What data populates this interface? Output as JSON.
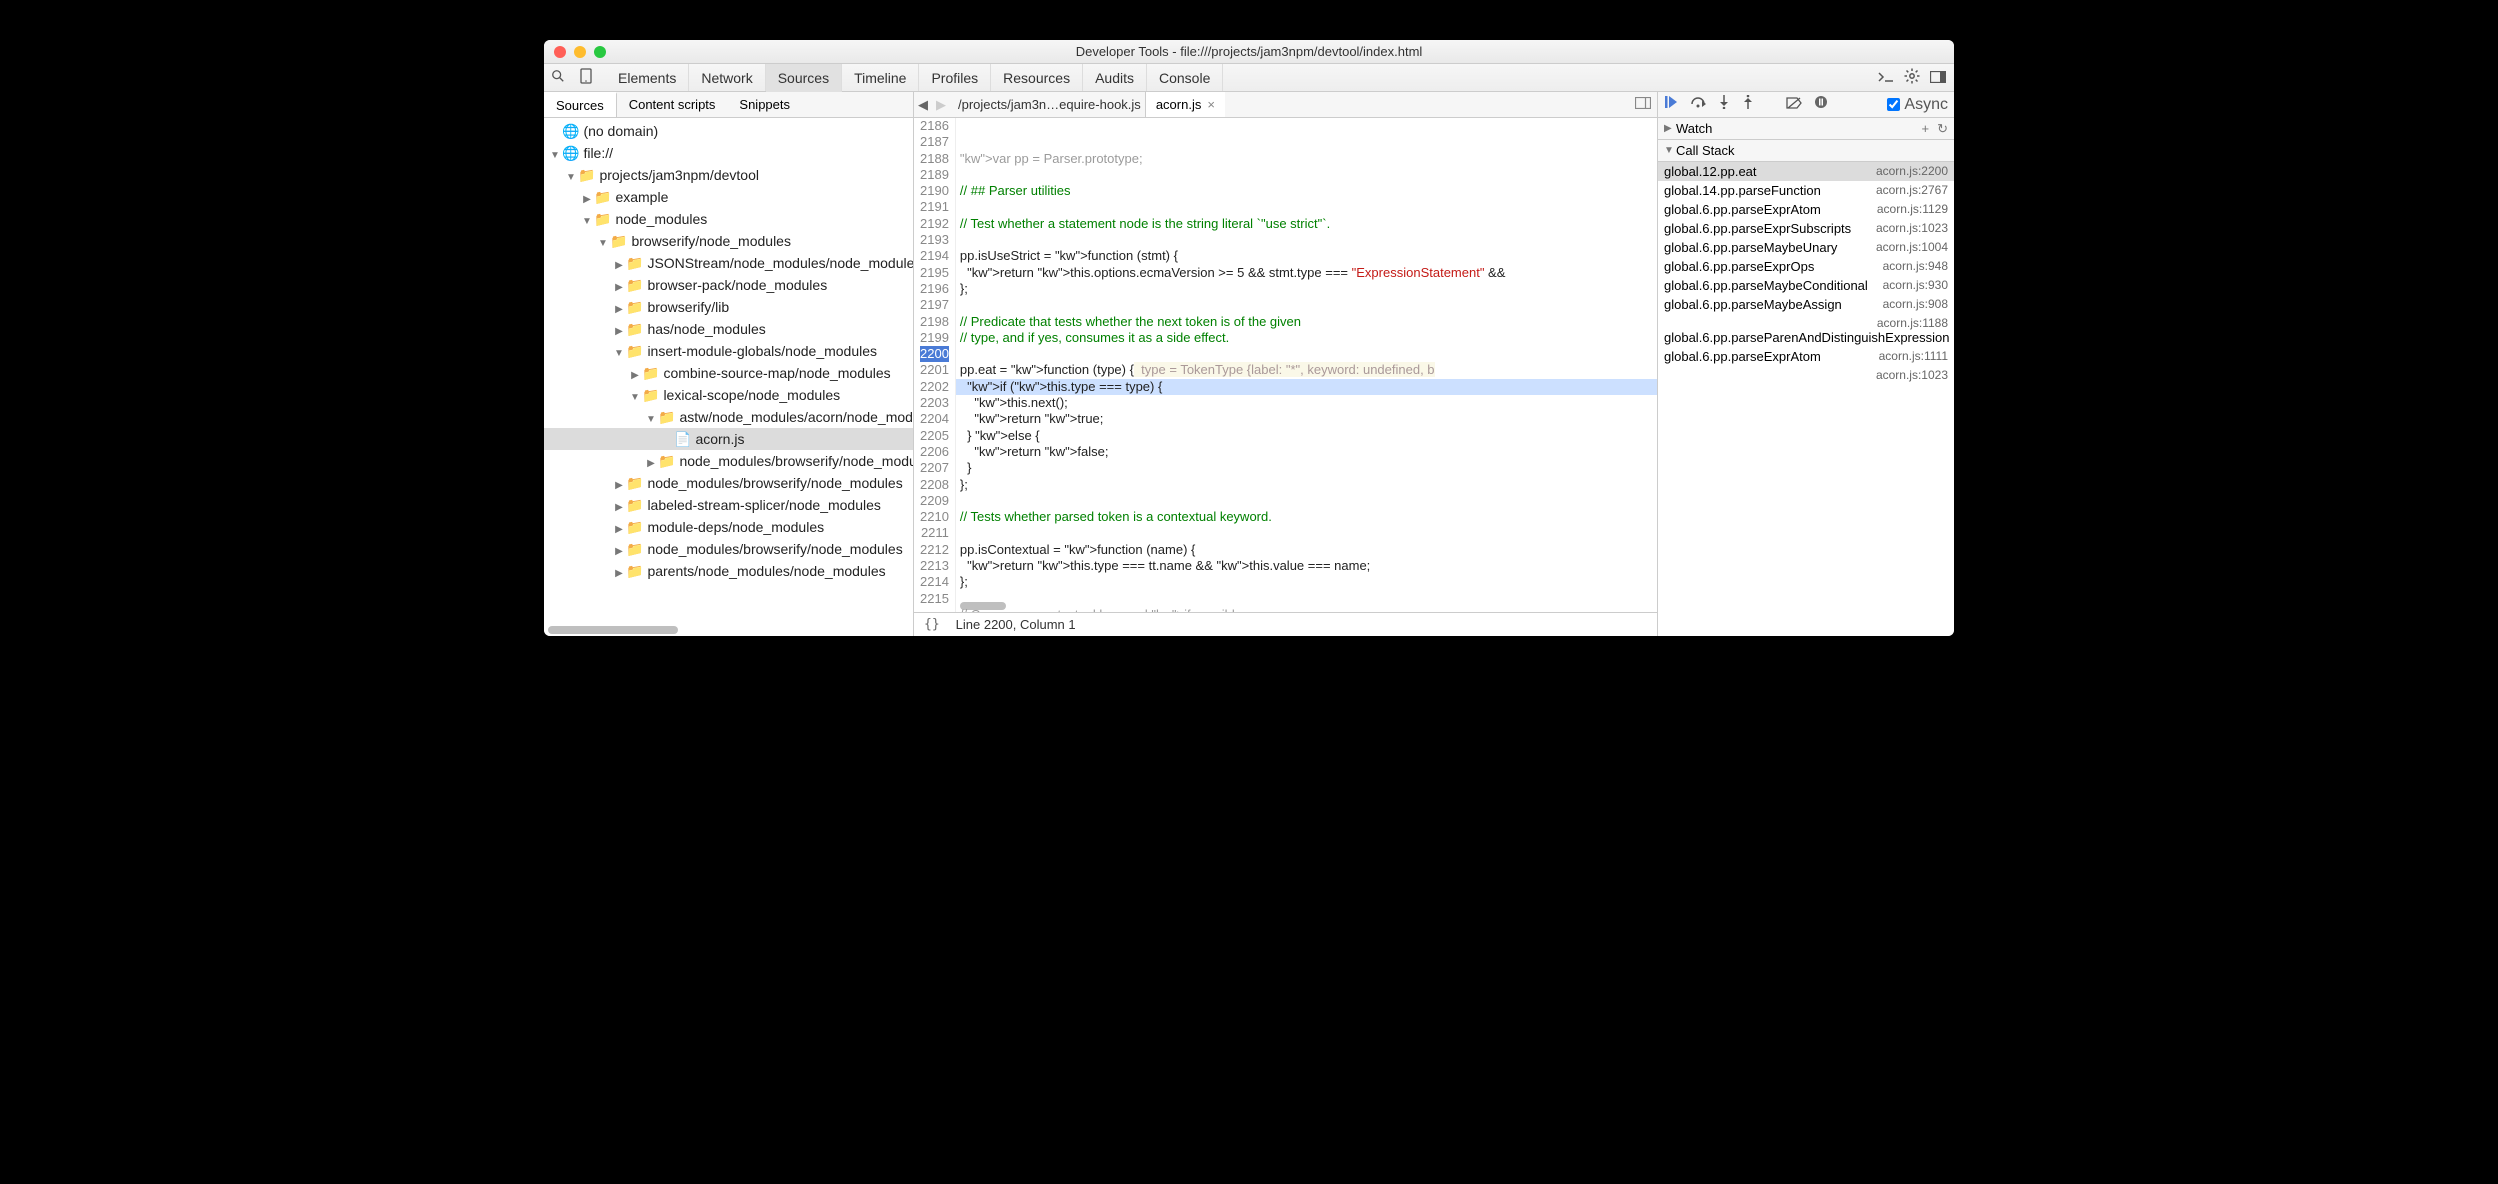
{
  "window": {
    "title": "Developer Tools - file:///projects/jam3npm/devtool/index.html"
  },
  "main_tabs": [
    "Elements",
    "Network",
    "Sources",
    "Timeline",
    "Profiles",
    "Resources",
    "Audits",
    "Console"
  ],
  "main_tab_active": "Sources",
  "panel_tabs": [
    "Sources",
    "Content scripts",
    "Snippets"
  ],
  "panel_tab_active": "Sources",
  "tree": [
    {
      "depth": 0,
      "open": true,
      "icon": "globe",
      "label": "(no domain)",
      "nochild": true
    },
    {
      "depth": 0,
      "open": true,
      "icon": "globe",
      "label": "file://"
    },
    {
      "depth": 1,
      "open": true,
      "icon": "folder",
      "label": "projects/jam3npm/devtool"
    },
    {
      "depth": 2,
      "open": false,
      "icon": "folder",
      "label": "example"
    },
    {
      "depth": 2,
      "open": true,
      "icon": "folder",
      "label": "node_modules"
    },
    {
      "depth": 3,
      "open": true,
      "icon": "folder",
      "label": "browserify/node_modules"
    },
    {
      "depth": 4,
      "open": false,
      "icon": "folder",
      "label": "JSONStream/node_modules/node_modules"
    },
    {
      "depth": 4,
      "open": false,
      "icon": "folder",
      "label": "browser-pack/node_modules"
    },
    {
      "depth": 4,
      "open": false,
      "icon": "folder",
      "label": "browserify/lib"
    },
    {
      "depth": 4,
      "open": false,
      "icon": "folder",
      "label": "has/node_modules"
    },
    {
      "depth": 4,
      "open": true,
      "icon": "folder",
      "label": "insert-module-globals/node_modules"
    },
    {
      "depth": 5,
      "open": false,
      "icon": "folder",
      "label": "combine-source-map/node_modules"
    },
    {
      "depth": 5,
      "open": true,
      "icon": "folder",
      "label": "lexical-scope/node_modules"
    },
    {
      "depth": 6,
      "open": true,
      "icon": "folder",
      "label": "astw/node_modules/acorn/node_modules"
    },
    {
      "depth": 7,
      "open": false,
      "icon": "file",
      "label": "acorn.js",
      "sel": true,
      "leaf": true
    },
    {
      "depth": 6,
      "open": false,
      "icon": "folder",
      "label": "node_modules/browserify/node_modules"
    },
    {
      "depth": 4,
      "open": false,
      "icon": "folder",
      "label": "node_modules/browserify/node_modules"
    },
    {
      "depth": 4,
      "open": false,
      "icon": "folder",
      "label": "labeled-stream-splicer/node_modules"
    },
    {
      "depth": 4,
      "open": false,
      "icon": "folder",
      "label": "module-deps/node_modules"
    },
    {
      "depth": 4,
      "open": false,
      "icon": "folder",
      "label": "node_modules/browserify/node_modules"
    },
    {
      "depth": 4,
      "open": false,
      "icon": "folder",
      "label": "parents/node_modules/node_modules"
    }
  ],
  "editor": {
    "crumb": "/projects/jam3n…equire-hook.js",
    "active_tab": "acorn.js",
    "first_line": 2186,
    "current_line": 2200,
    "lines": [
      {
        "t": "var pp = Parser.prototype;",
        "cls": "kw faded"
      },
      {
        "t": ""
      },
      {
        "t": "// ## Parser utilities",
        "cls": "cm"
      },
      {
        "t": ""
      },
      {
        "t": "// Test whether a statement node is the string literal `\"use strict\"`.",
        "cls": "cm"
      },
      {
        "t": ""
      },
      {
        "t": "pp.isUseStrict = function (stmt) {"
      },
      {
        "t": "  return this.options.ecmaVersion >= 5 && stmt.type === \"ExpressionStatement\" &&"
      },
      {
        "t": "};"
      },
      {
        "t": ""
      },
      {
        "t": "// Predicate that tests whether the next token is of the given",
        "cls": "cm"
      },
      {
        "t": "// type, and if yes, consumes it as a side effect.",
        "cls": "cm"
      },
      {
        "t": ""
      },
      {
        "t": "pp.eat = function (type) {",
        "hint": "  type = TokenType {label: \"*\", keyword: undefined, b"
      },
      {
        "t": "  if (this.type === type) {",
        "hl": true
      },
      {
        "t": "    this.next();"
      },
      {
        "t": "    return true;"
      },
      {
        "t": "  } else {"
      },
      {
        "t": "    return false;"
      },
      {
        "t": "  }"
      },
      {
        "t": "};"
      },
      {
        "t": ""
      },
      {
        "t": "// Tests whether parsed token is a contextual keyword.",
        "cls": "cm"
      },
      {
        "t": ""
      },
      {
        "t": "pp.isContextual = function (name) {"
      },
      {
        "t": "  return this.type === tt.name && this.value === name;"
      },
      {
        "t": "};"
      },
      {
        "t": ""
      },
      {
        "t": "// Consumes contextual keyword if possible",
        "cls": "cm faded"
      },
      {
        "t": ""
      }
    ]
  },
  "status": {
    "braces": "{}",
    "cursor": "Line 2200, Column 1"
  },
  "watch": {
    "label": "Watch"
  },
  "callstack": {
    "label": "Call Stack",
    "frames": [
      {
        "fn": "global.12.pp.eat",
        "loc": "acorn.js:2200",
        "sel": true
      },
      {
        "fn": "global.14.pp.parseFunction",
        "loc": "acorn.js:2767"
      },
      {
        "fn": "global.6.pp.parseExprAtom",
        "loc": "acorn.js:1129"
      },
      {
        "fn": "global.6.pp.parseExprSubscripts",
        "loc": "acorn.js:1023"
      },
      {
        "fn": "global.6.pp.parseMaybeUnary",
        "loc": "acorn.js:1004"
      },
      {
        "fn": "global.6.pp.parseExprOps",
        "loc": "acorn.js:948"
      },
      {
        "fn": "global.6.pp.parseMaybeConditional",
        "loc": "acorn.js:930"
      },
      {
        "fn": "global.6.pp.parseMaybeAssign",
        "loc": "acorn.js:908"
      },
      {
        "fn": "global.6.pp.parseParenAndDistinguishExpression",
        "loc": "acorn.js:1188"
      },
      {
        "fn": "global.6.pp.parseExprAtom",
        "loc": "acorn.js:1111"
      },
      {
        "fn": "",
        "loc": "acorn.js:1023"
      }
    ]
  },
  "async_label": "Async"
}
